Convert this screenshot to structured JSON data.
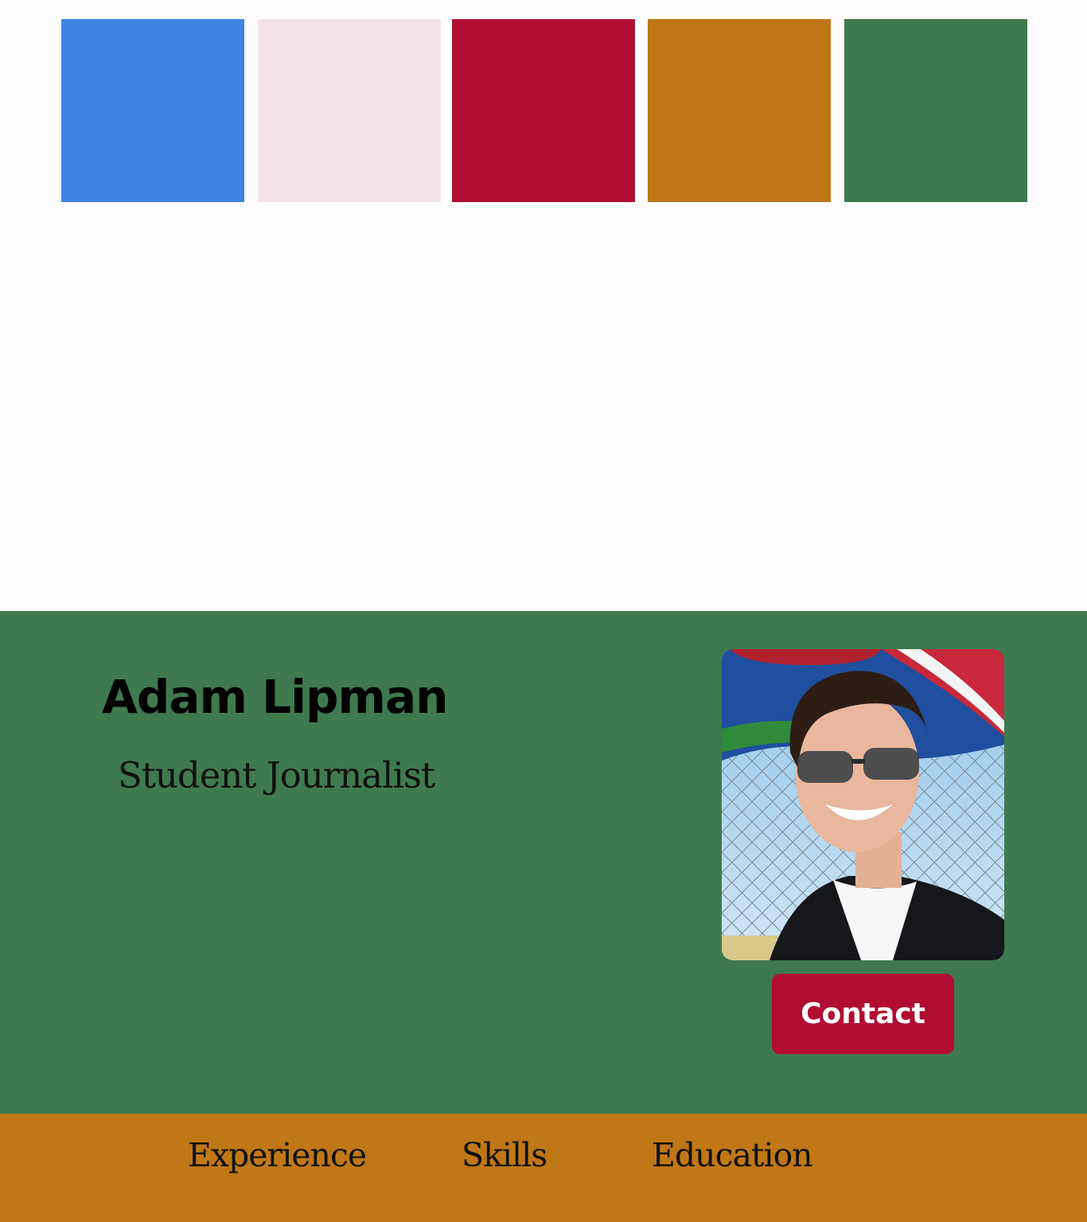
{
  "palette": {
    "swatches": [
      "#3e84e3",
      "#f1e3e8",
      "#b10d32",
      "#c07716",
      "#3f7a4f"
    ]
  },
  "hero": {
    "name": "Adam Lipman",
    "subtitle": "Student Journalist",
    "background": "#3f7a4f",
    "photo_alt": "Portrait photo of Adam Lipman",
    "contact_label": "Contact",
    "contact_color": "#b10d32"
  },
  "nav": {
    "background": "#c07716",
    "items": [
      "Experience",
      "Skills",
      "Education"
    ]
  }
}
